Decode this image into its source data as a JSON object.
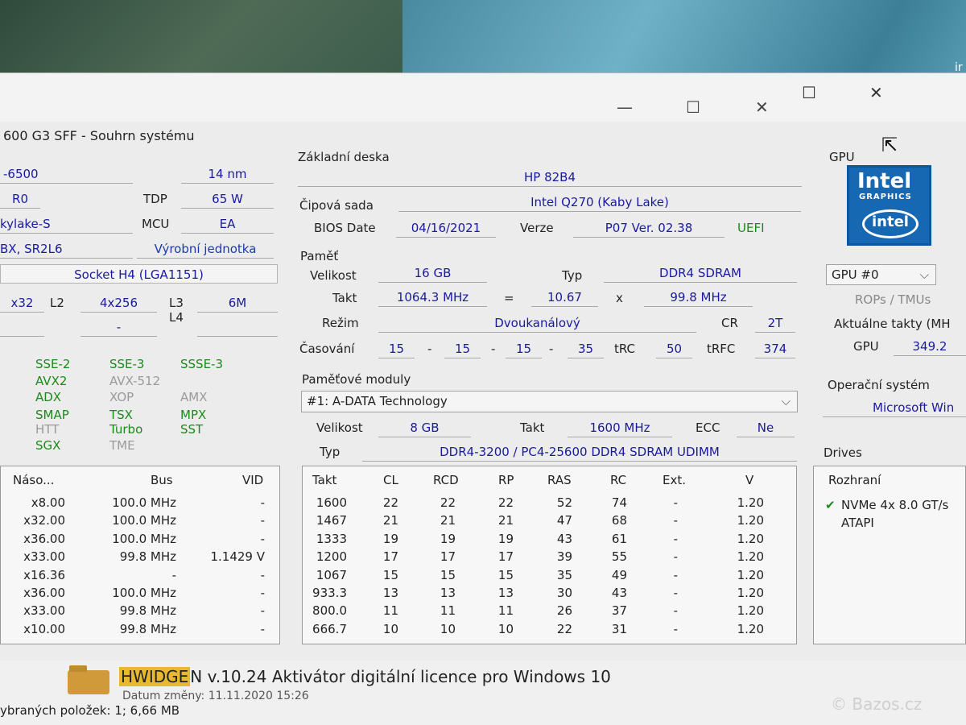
{
  "window": {
    "title": "600 G3 SFF - Souhrn systému",
    "controls": [
      "—",
      "☐",
      "✕"
    ],
    "outer_controls": [
      "☐",
      "✕"
    ]
  },
  "cpu": {
    "name": "-6500",
    "process": "14 nm",
    "stepping": "R0",
    "tdp_label": "TDP",
    "tdp": "65 W",
    "codename": "kylake-S",
    "mcu_label": "MCU",
    "mcu": "EA",
    "sspec": "BX, SR2L6",
    "unit_link": "Výrobní jednotka",
    "socket": "Socket H4 (LGA1151)",
    "cache": {
      "l1": "x32",
      "l2_label": "L2",
      "l2": "4x256",
      "l3_label": "L3",
      "l3": "6M",
      "l4_label": "L4",
      "l4": "-"
    },
    "features": [
      {
        "name": "SSE-2",
        "state": "on"
      },
      {
        "name": "SSE-3",
        "state": "on"
      },
      {
        "name": "SSSE-3",
        "state": "on"
      },
      {
        "name": "AVX2",
        "state": "on"
      },
      {
        "name": "AVX-512",
        "state": "off"
      },
      {
        "name": "ADX",
        "state": "on"
      },
      {
        "name": "XOP",
        "state": "off"
      },
      {
        "name": "AMX",
        "state": "off"
      },
      {
        "name": "SMAP",
        "state": "on"
      },
      {
        "name": "TSX",
        "state": "on"
      },
      {
        "name": "MPX",
        "state": "on"
      },
      {
        "name": "HTT",
        "state": "off"
      },
      {
        "name": "Turbo",
        "state": "on"
      },
      {
        "name": "SST",
        "state": "on"
      },
      {
        "name": "SGX",
        "state": "on"
      },
      {
        "name": "TME",
        "state": "off"
      }
    ],
    "clock_table": {
      "headers": [
        "Náso...",
        "Bus",
        "VID"
      ],
      "rows": [
        [
          "x8.00",
          "100.0 MHz",
          "-"
        ],
        [
          "x32.00",
          "100.0 MHz",
          "-"
        ],
        [
          "x36.00",
          "100.0 MHz",
          "-"
        ],
        [
          "x33.00",
          "99.8 MHz",
          "1.1429 V"
        ],
        [
          "x16.36",
          "-",
          "-"
        ],
        [
          "x36.00",
          "100.0 MHz",
          "-"
        ],
        [
          "x33.00",
          "99.8 MHz",
          "-"
        ],
        [
          "x10.00",
          "99.8 MHz",
          "-"
        ]
      ]
    }
  },
  "motherboard": {
    "label": "Základní deska",
    "model": "HP 82B4",
    "chipset_label": "Čipová sada",
    "chipset": "Intel Q270 (Kaby Lake)",
    "bios_date_label": "BIOS Date",
    "bios_date": "04/16/2021",
    "version_label": "Verze",
    "version": "P07 Ver. 02.38",
    "uefi": "UEFI"
  },
  "memory": {
    "label": "Paměť",
    "size_label": "Velikost",
    "size": "16 GB",
    "type_label": "Typ",
    "type": "DDR4 SDRAM",
    "clock_label": "Takt",
    "clock": "1064.3 MHz",
    "eq": "=",
    "mult": "10.67",
    "x": "x",
    "bus": "99.8 MHz",
    "mode_label": "Režim",
    "mode": "Dvoukanálový",
    "cr_label": "CR",
    "cr": "2T",
    "timing_label": "Časování",
    "timings": [
      "15",
      "15",
      "15",
      "35"
    ],
    "dash": "-",
    "trc_label": "tRC",
    "trc": "50",
    "trfc_label": "tRFC",
    "trfc": "374"
  },
  "modules": {
    "label": "Paměťové moduly",
    "selected": "#1: A-DATA Technology",
    "size_label": "Velikost",
    "size": "8 GB",
    "clock_label": "Takt",
    "clock": "1600 MHz",
    "ecc_label": "ECC",
    "ecc": "Ne",
    "type_label": "Typ",
    "type": "DDR4-3200 / PC4-25600 DDR4 SDRAM UDIMM",
    "table": {
      "headers": [
        "Takt",
        "CL",
        "RCD",
        "RP",
        "RAS",
        "RC",
        "Ext.",
        "V"
      ],
      "rows": [
        [
          "1600",
          "22",
          "22",
          "22",
          "52",
          "74",
          "-",
          "1.20"
        ],
        [
          "1467",
          "21",
          "21",
          "21",
          "47",
          "68",
          "-",
          "1.20"
        ],
        [
          "1333",
          "19",
          "19",
          "19",
          "43",
          "61",
          "-",
          "1.20"
        ],
        [
          "1200",
          "17",
          "17",
          "17",
          "39",
          "55",
          "-",
          "1.20"
        ],
        [
          "1067",
          "15",
          "15",
          "15",
          "35",
          "49",
          "-",
          "1.20"
        ],
        [
          "933.3",
          "13",
          "13",
          "13",
          "30",
          "43",
          "-",
          "1.20"
        ],
        [
          "800.0",
          "11",
          "11",
          "11",
          "26",
          "37",
          "-",
          "1.20"
        ],
        [
          "666.7",
          "10",
          "10",
          "10",
          "22",
          "31",
          "-",
          "1.20"
        ]
      ]
    }
  },
  "gpu": {
    "label": "GPU",
    "logo_text": "Intel",
    "logo_sub": "GRAPHICS",
    "logo_inner": "intel",
    "selector": "GPU #0",
    "rops": "ROPs / TMUs",
    "current_clocks": "Aktuálne takty (MH",
    "gpu_label": "GPU",
    "gpu_clock": "349.2"
  },
  "os": {
    "label": "Operační systém",
    "value": "Microsoft Win"
  },
  "drives": {
    "label": "Drives",
    "header": "Rozhraní",
    "items": [
      "NVMe 4x 8.0 GT/s",
      "ATAPI"
    ],
    "check": "✔"
  },
  "taskbar": {
    "file_name": "HWIDGEN v.10.24 Aktivátor digitální licence pro Windows 10",
    "file_meta": "Datum změny: 11.11.2020 15:26",
    "selection": "ybraných položek: 1; 6,66 MB",
    "watermark": "Bazos.cz",
    "corner": "ir"
  },
  "colors": {
    "value_text": "#1a1aa0",
    "feature_on": "#1a8a1a",
    "feature_off": "#9a9a9a",
    "intel_blue": "#1768b3"
  }
}
